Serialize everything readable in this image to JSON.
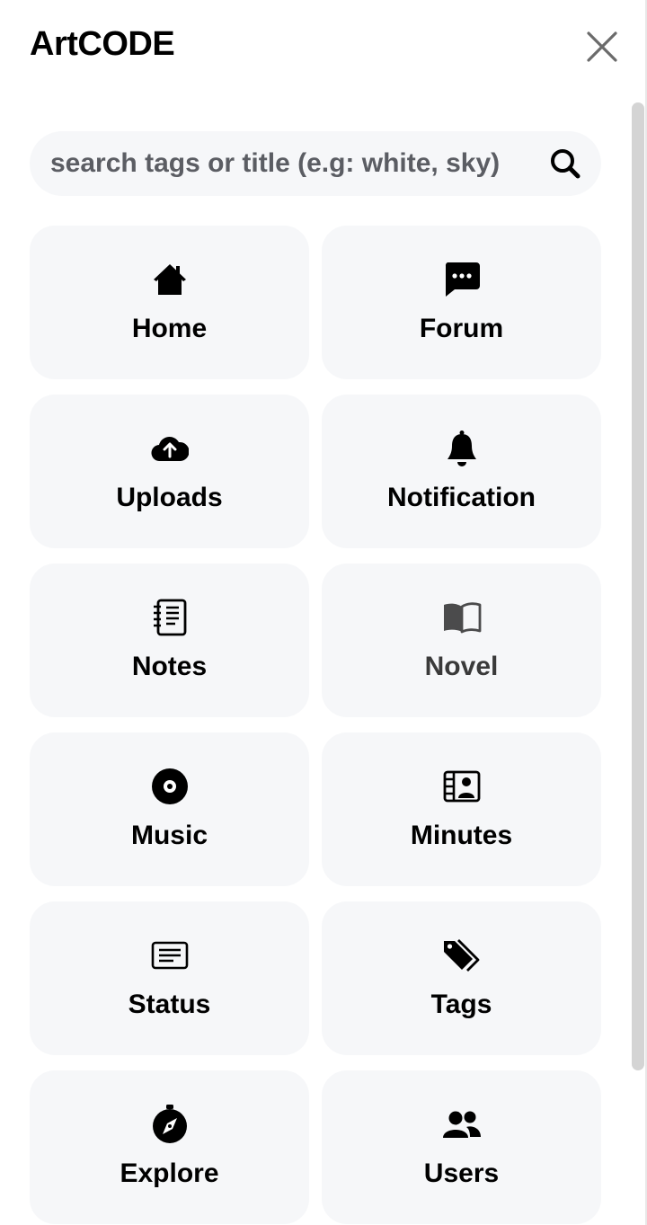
{
  "header": {
    "title": "ArtCODE"
  },
  "search": {
    "placeholder": "search tags or title (e.g: white, sky)",
    "value": ""
  },
  "menu": [
    {
      "label": "Home",
      "icon": "home-icon"
    },
    {
      "label": "Forum",
      "icon": "chat-dots-icon"
    },
    {
      "label": "Uploads",
      "icon": "cloud-upload-icon"
    },
    {
      "label": "Notification",
      "icon": "bell-icon"
    },
    {
      "label": "Notes",
      "icon": "notebook-icon"
    },
    {
      "label": "Novel",
      "icon": "book-icon"
    },
    {
      "label": "Music",
      "icon": "disc-icon"
    },
    {
      "label": "Minutes",
      "icon": "video-card-icon"
    },
    {
      "label": "Status",
      "icon": "card-text-icon"
    },
    {
      "label": "Tags",
      "icon": "tags-icon"
    },
    {
      "label": "Explore",
      "icon": "compass-icon"
    },
    {
      "label": "Users",
      "icon": "people-icon"
    }
  ]
}
